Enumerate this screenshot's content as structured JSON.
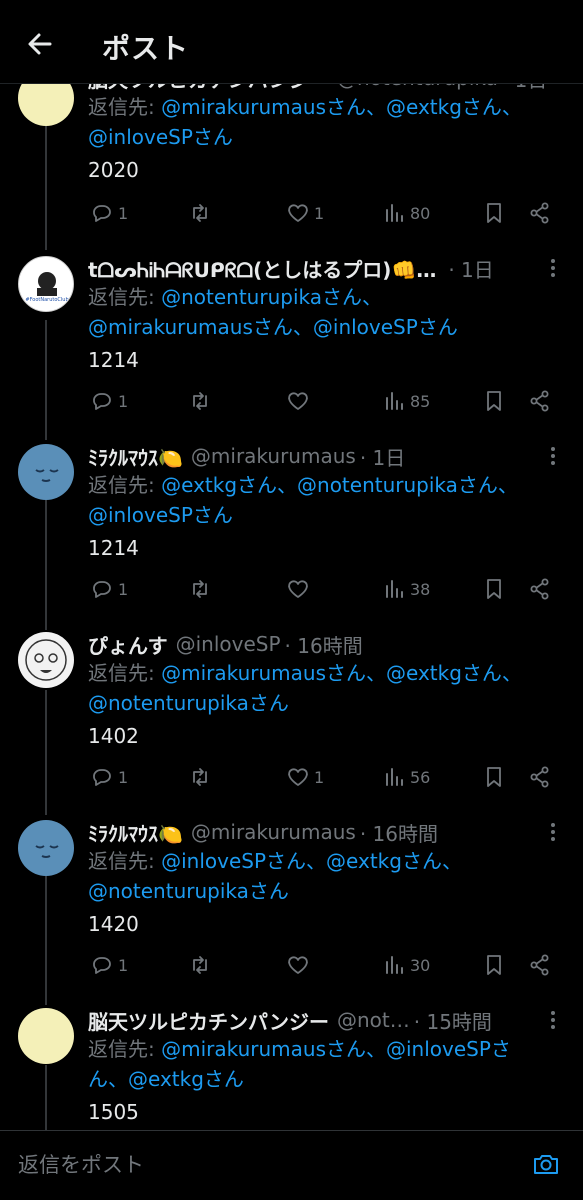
{
  "header": {
    "title": "ポスト"
  },
  "posts": [
    {
      "name": "脳天ツルピカチンパンジー",
      "handle": "@notenturupika",
      "time": "· 1日",
      "reply_prefix": "返信先: ",
      "reply_lines": [
        "@mirakurumausさん、@extkgさん、",
        "@inloveSPさん"
      ],
      "text": "2020",
      "replies": "1",
      "reposts": "",
      "likes": "1",
      "views": "80"
    },
    {
      "name": "tᗝᔕᏂᎥᏂᗩᖇᑌᑭᖇᗝ(としはるプロ)👊…",
      "handle": "",
      "time": "· 1日",
      "reply_prefix": "返信先: ",
      "reply_lines": [
        "@notenturupikaさん、",
        "@mirakurumausさん、@inloveSPさん"
      ],
      "text": "1214",
      "replies": "1",
      "reposts": "",
      "likes": "",
      "views": "85"
    },
    {
      "name": "ﾐﾗｸﾙﾏｳｽ🍋",
      "handle": "@mirakurumaus",
      "time": "· 1日",
      "reply_prefix": "返信先: ",
      "reply_lines": [
        "@extkgさん、@notenturupikaさん、",
        "@inloveSPさん"
      ],
      "text": "1214",
      "replies": "1",
      "reposts": "",
      "likes": "",
      "views": "38"
    },
    {
      "name": "ぴょんす",
      "handle": "@inloveSP",
      "time": "· 16時間",
      "reply_prefix": "返信先: ",
      "reply_lines": [
        "@mirakurumausさん、@extkgさん、",
        "@notenturupikaさん"
      ],
      "text": "1402",
      "replies": "1",
      "reposts": "",
      "likes": "1",
      "views": "56"
    },
    {
      "name": "ﾐﾗｸﾙﾏｳｽ🍋",
      "handle": "@mirakurumaus",
      "time": "· 16時間",
      "reply_prefix": "返信先: ",
      "reply_lines": [
        "@inloveSPさん、@extkgさん、",
        "@notenturupikaさん"
      ],
      "text": "1420",
      "replies": "1",
      "reposts": "",
      "likes": "",
      "views": "30"
    },
    {
      "name": "脳天ツルピカチンパンジー",
      "handle": "@not…",
      "time": "· 15時間",
      "reply_prefix": "返信先: ",
      "reply_lines": [
        "@mirakurumausさん、@inloveSPさ",
        "ん、@extkgさん"
      ],
      "text": "1505",
      "replies": "",
      "reposts": "",
      "likes": "",
      "views": ""
    }
  ],
  "avatars": {
    "club_badge": "#FootNarutoClub"
  },
  "composer": {
    "placeholder": "返信をポスト"
  },
  "colors": {
    "background": "#000000",
    "link": "#1d9bf0",
    "muted": "#71767b",
    "text": "#e7e9ea"
  },
  "icons": [
    "back-arrow-icon",
    "more-dots-icon",
    "reply-icon",
    "repost-icon",
    "like-icon",
    "views-icon",
    "bookmark-icon",
    "share-icon",
    "camera-icon"
  ]
}
